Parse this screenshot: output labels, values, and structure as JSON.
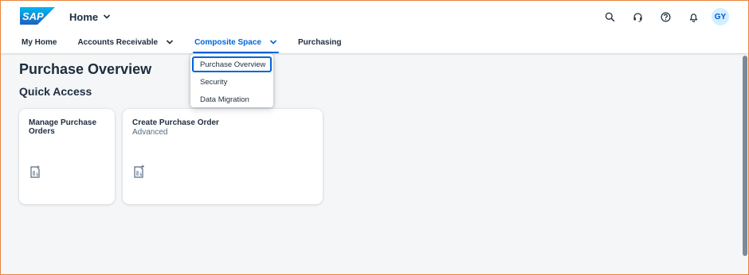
{
  "shell": {
    "logo_text": "SAP",
    "home_title": "Home",
    "avatar_initials": "GY",
    "brand_color": "#0070f2",
    "accent_color": "#0064d9",
    "actions": [
      {
        "icon": "search-icon"
      },
      {
        "icon": "headset-icon"
      },
      {
        "icon": "help-icon"
      },
      {
        "icon": "bell-icon"
      }
    ]
  },
  "nav": {
    "tabs": [
      {
        "label": "My Home",
        "has_menu": false,
        "active": false
      },
      {
        "label": "Accounts Receivable",
        "has_menu": true,
        "active": false
      },
      {
        "label": "Composite Space",
        "has_menu": true,
        "active": true
      },
      {
        "label": "Purchasing",
        "has_menu": false,
        "active": false
      }
    ]
  },
  "dropdown": {
    "items": [
      {
        "label": "Purchase Overview",
        "focused": true
      },
      {
        "label": "Security",
        "focused": false
      },
      {
        "label": "Data Migration",
        "focused": false
      }
    ]
  },
  "page": {
    "title": "Purchase Overview",
    "section_title": "Quick Access"
  },
  "tiles": [
    {
      "title": "Manage Purchase Orders",
      "subtitle": "",
      "icon": "purchase-order-icon"
    },
    {
      "title": "Create Purchase Order",
      "subtitle": "Advanced",
      "icon": "create-purchase-order-icon"
    }
  ]
}
